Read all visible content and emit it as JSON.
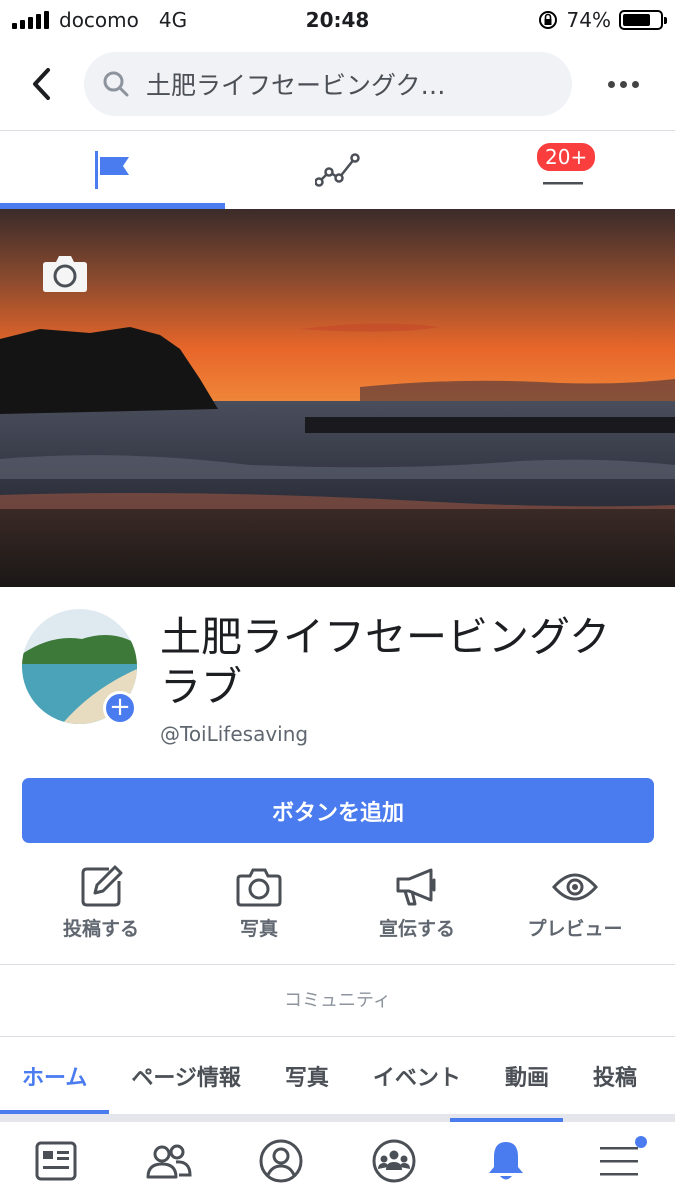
{
  "status_bar": {
    "carrier": "docomo",
    "network": "4G",
    "time": "20:48",
    "battery": "74%",
    "battery_level": 0.74
  },
  "search": {
    "query": "土肥ライフセービングク…"
  },
  "page_tabs": {
    "badge": "20+"
  },
  "profile": {
    "name": "土肥ライフセービングクラブ",
    "handle": "@ToiLifesaving"
  },
  "primary_button": "ボタンを追加",
  "actions": [
    {
      "label": "投稿する",
      "icon": "edit-icon"
    },
    {
      "label": "写真",
      "icon": "camera-icon"
    },
    {
      "label": "宣伝する",
      "icon": "megaphone-icon"
    },
    {
      "label": "プレビュー",
      "icon": "eye-icon"
    }
  ],
  "category": "コミュニティ",
  "section_tabs": [
    "ホーム",
    "ページ情報",
    "写真",
    "イベント",
    "動画",
    "投稿"
  ],
  "colors": {
    "accent": "#4a7cf0",
    "badge": "#fa3e3e",
    "text": "#1c1e21",
    "muted": "#606770"
  }
}
